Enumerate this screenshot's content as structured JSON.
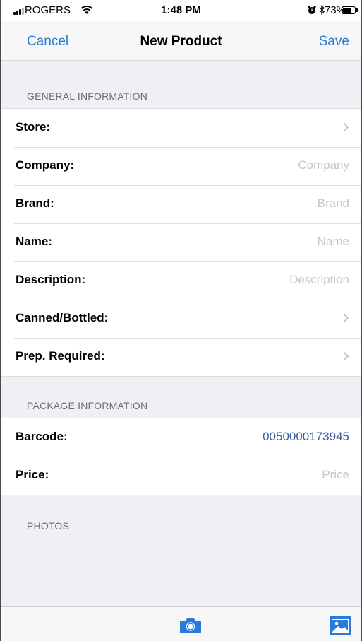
{
  "status_bar": {
    "carrier": "ROGERS",
    "time": "1:48 PM",
    "battery_percent": "73%",
    "battery_level": 0.73
  },
  "nav": {
    "cancel_label": "Cancel",
    "title": "New Product",
    "save_label": "Save"
  },
  "sections": {
    "general": {
      "header": "GENERAL INFORMATION",
      "rows": [
        {
          "label": "Store:",
          "value": "",
          "type": "disclosure"
        },
        {
          "label": "Company:",
          "placeholder": "Company",
          "type": "text"
        },
        {
          "label": "Brand:",
          "placeholder": "Brand",
          "type": "text"
        },
        {
          "label": "Name:",
          "placeholder": "Name",
          "type": "text"
        },
        {
          "label": "Description:",
          "placeholder": "Description",
          "type": "text"
        },
        {
          "label": "Canned/Bottled:",
          "value": "",
          "type": "disclosure"
        },
        {
          "label": "Prep. Required:",
          "value": "",
          "type": "disclosure"
        }
      ]
    },
    "package": {
      "header": "PACKAGE INFORMATION",
      "rows": [
        {
          "label": "Barcode:",
          "value": "0050000173945",
          "type": "text"
        },
        {
          "label": "Price:",
          "placeholder": "Price",
          "type": "text"
        }
      ]
    },
    "photos": {
      "header": "PHOTOS"
    }
  },
  "toolbar": {
    "camera_icon": "camera-icon",
    "photos_icon": "photo-library-icon"
  },
  "colors": {
    "accent": "#2a7bd8",
    "barcode_value": "#3a5aa0",
    "placeholder": "#c7c7cd",
    "grouped_background": "#efeff4"
  }
}
